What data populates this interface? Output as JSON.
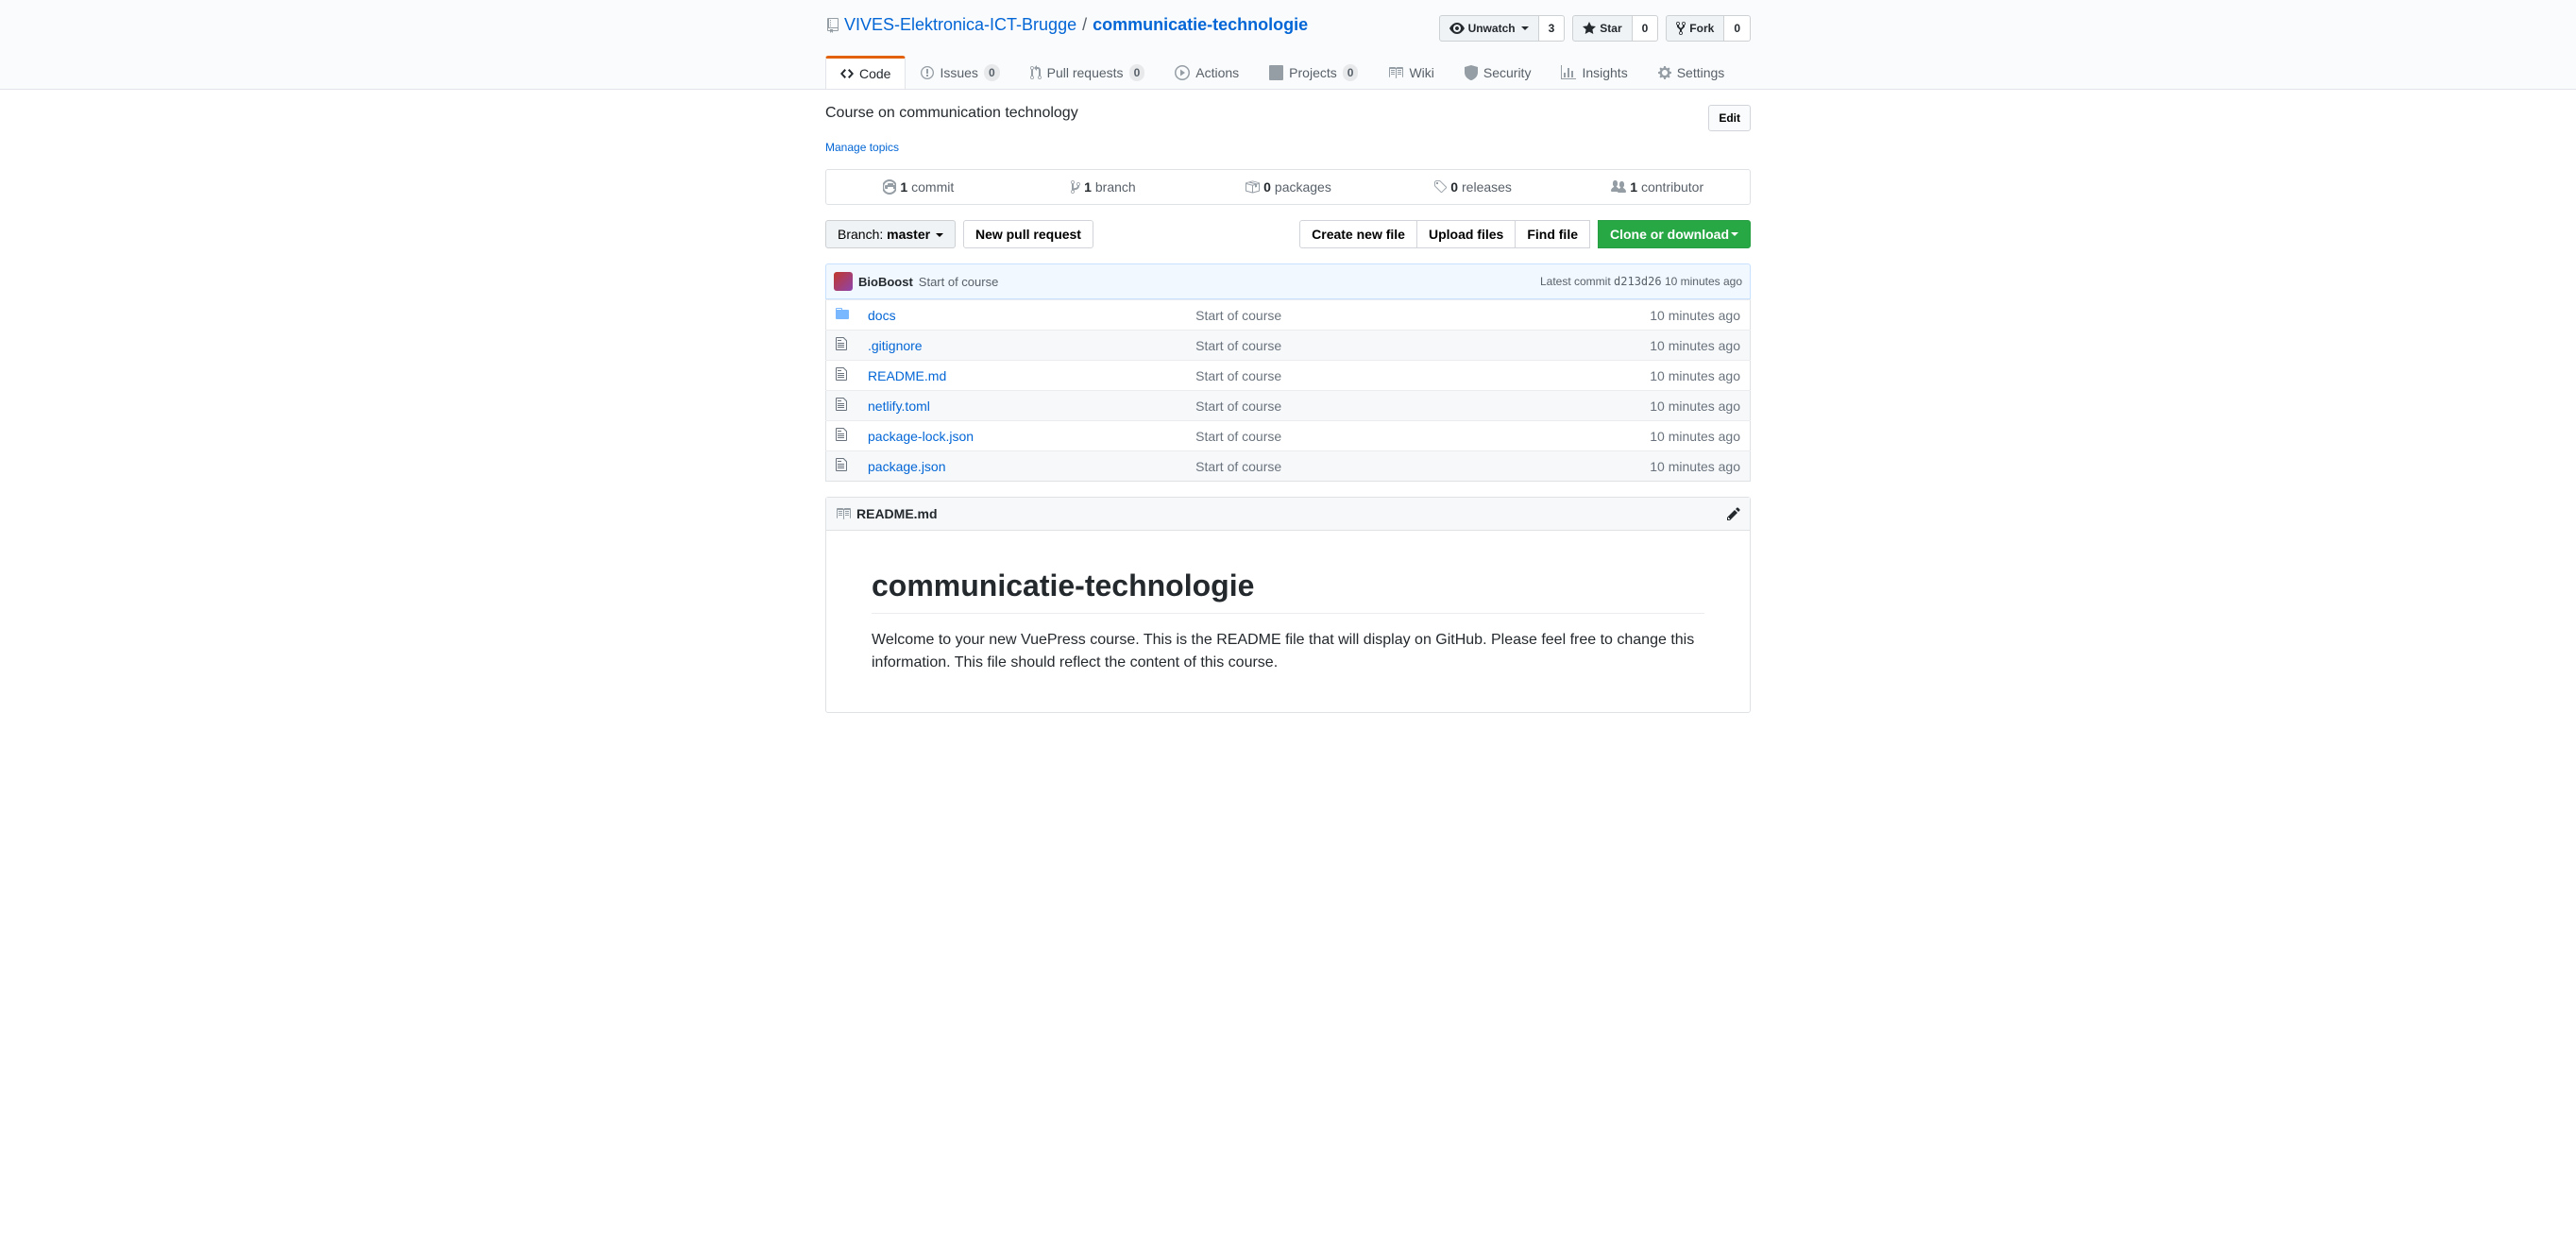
{
  "repo": {
    "owner": "VIVES-Elektronica-ICT-Brugge",
    "name": "communicatie-technologie",
    "separator": "/"
  },
  "actions": {
    "watch": {
      "label": "Unwatch",
      "count": "3"
    },
    "star": {
      "label": "Star",
      "count": "0"
    },
    "fork": {
      "label": "Fork",
      "count": "0"
    }
  },
  "tabs": {
    "code": "Code",
    "issues": {
      "label": "Issues",
      "count": "0"
    },
    "pulls": {
      "label": "Pull requests",
      "count": "0"
    },
    "actions": "Actions",
    "projects": {
      "label": "Projects",
      "count": "0"
    },
    "wiki": "Wiki",
    "security": "Security",
    "insights": "Insights",
    "settings": "Settings"
  },
  "description": "Course on communication technology",
  "manage_topics": "Manage topics",
  "edit_btn": "Edit",
  "stats": {
    "commits": {
      "count": "1",
      "label": "commit"
    },
    "branches": {
      "count": "1",
      "label": "branch"
    },
    "packages": {
      "count": "0",
      "label": "packages"
    },
    "releases": {
      "count": "0",
      "label": "releases"
    },
    "contributors": {
      "count": "1",
      "label": "contributor"
    }
  },
  "branch": {
    "prefix": "Branch:",
    "name": "master"
  },
  "new_pr": "New pull request",
  "file_actions": {
    "create": "Create new file",
    "upload": "Upload files",
    "find": "Find file",
    "clone": "Clone or download"
  },
  "latest_commit": {
    "author": "BioBoost",
    "message": "Start of course",
    "label": "Latest commit",
    "sha": "d213d26",
    "time": "10 minutes ago"
  },
  "files": [
    {
      "type": "dir",
      "name": "docs",
      "msg": "Start of course",
      "time": "10 minutes ago"
    },
    {
      "type": "file",
      "name": ".gitignore",
      "msg": "Start of course",
      "time": "10 minutes ago"
    },
    {
      "type": "file",
      "name": "README.md",
      "msg": "Start of course",
      "time": "10 minutes ago"
    },
    {
      "type": "file",
      "name": "netlify.toml",
      "msg": "Start of course",
      "time": "10 minutes ago"
    },
    {
      "type": "file",
      "name": "package-lock.json",
      "msg": "Start of course",
      "time": "10 minutes ago"
    },
    {
      "type": "file",
      "name": "package.json",
      "msg": "Start of course",
      "time": "10 minutes ago"
    }
  ],
  "readme": {
    "filename": "README.md",
    "title": "communicatie-technologie",
    "body": "Welcome to your new VuePress course. This is the README file that will display on GitHub. Please feel free to change this information. This file should reflect the content of this course."
  }
}
